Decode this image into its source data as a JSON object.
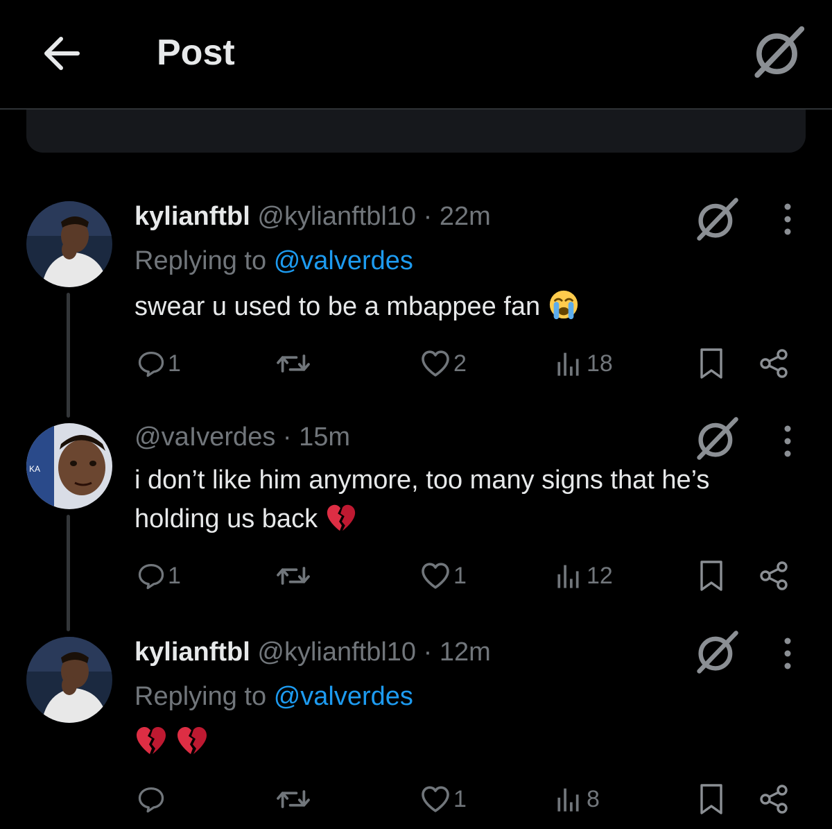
{
  "header": {
    "title": "Post",
    "back_icon": "arrow-left-icon",
    "grok_icon": "grok-icon"
  },
  "posts": [
    {
      "display_name": "kylianftbl",
      "handle": "@kylianftbl10",
      "separator": "·",
      "time": "22m",
      "replying_label": "Replying to",
      "replying_to": "@valverdes",
      "text": "swear u used to be a mbappee fan",
      "emoji": "loudly-crying-face",
      "replies": "1",
      "reposts": "",
      "likes": "2",
      "views": "18"
    },
    {
      "display_name": "",
      "handle": "@vaIverdes",
      "separator": "·",
      "time": "15m",
      "text": "i don’t like him anymore, too many signs that he’s holding us back",
      "emoji": "broken-heart",
      "replies": "1",
      "reposts": "",
      "likes": "1",
      "views": "12"
    },
    {
      "display_name": "kylianftbl",
      "handle": "@kylianftbl10",
      "separator": "·",
      "time": "12m",
      "replying_label": "Replying to",
      "replying_to": "@valverdes",
      "text": "",
      "emoji": "broken-heart broken-heart",
      "replies": "",
      "reposts": "",
      "likes": "1",
      "views": "8"
    }
  ],
  "colors": {
    "background": "#000000",
    "text": "#e7e9ea",
    "muted": "#71767b",
    "link": "#1d9bf0",
    "card": "#16181c",
    "divider": "#2f3336"
  }
}
